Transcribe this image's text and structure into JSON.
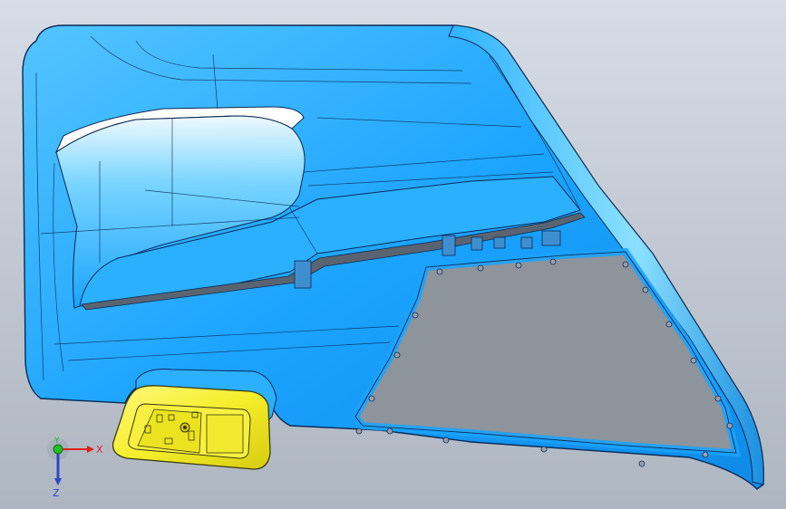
{
  "viewport": {
    "background_top": "#d7dde6",
    "background_bottom": "#aeb6c1"
  },
  "model": {
    "name": "door-trim-panel",
    "panel_color": "#1aa3ff",
    "panel_light": "#6cd0ff",
    "edge_color": "#0a2a55",
    "cutout_color": "#8e949b",
    "insert_color": "#f5ee2a",
    "insert_edge": "#3a3a10"
  },
  "triad": {
    "x_label": "X",
    "y_label": "Y",
    "z_label": "Z",
    "x_color": "#e0201c",
    "y_color": "#1fbf2a",
    "z_color": "#2d46c8"
  }
}
